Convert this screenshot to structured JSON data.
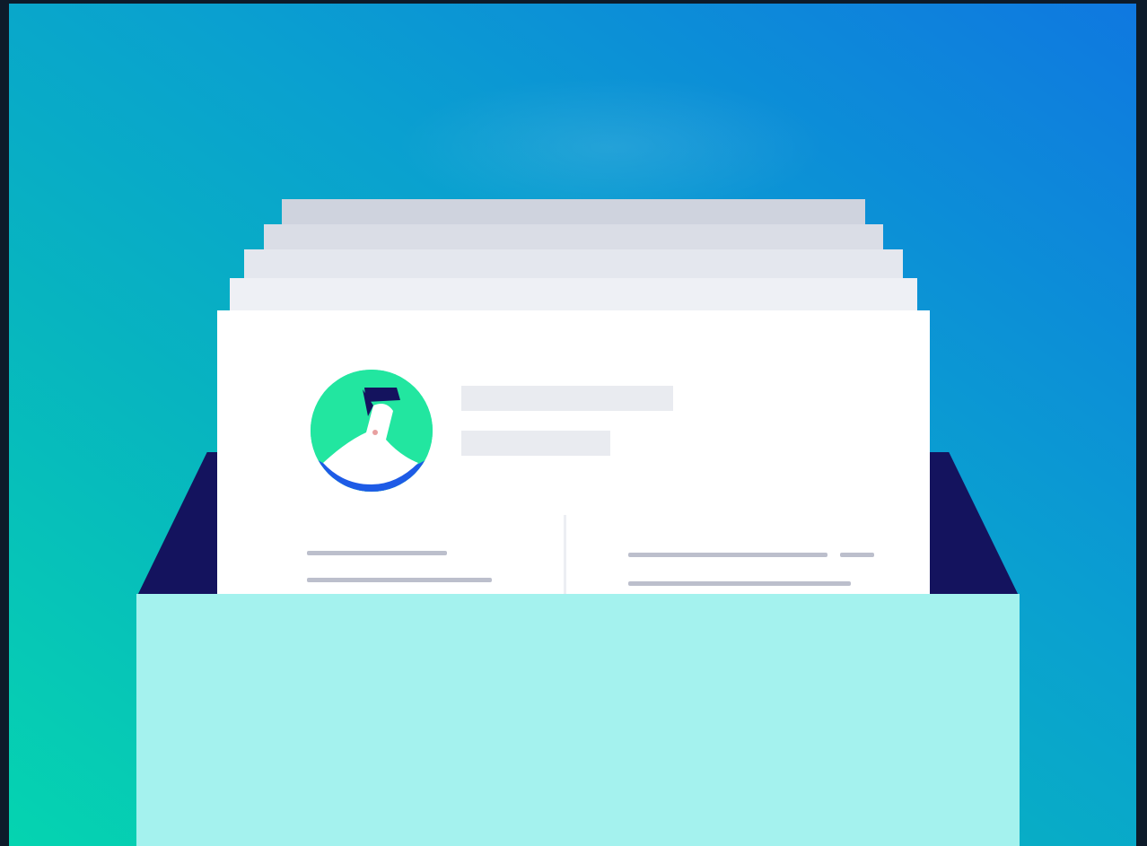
{
  "illustration": {
    "subject": "contact-card-holder",
    "colors": {
      "background_start": "#05d4b0",
      "background_end": "#0f78e0",
      "holder_flap": "#14135e",
      "holder_pocket": "#a4f2ee",
      "card": "#ffffff",
      "avatar_circle": "#22e6a0",
      "avatar_accent": "#1e5be6",
      "avatar_hair": "#14135e",
      "placeholder_line": "#bcbfcc",
      "placeholder_block": "#e9ebf0"
    },
    "icons": [
      "user-avatar-icon"
    ]
  }
}
